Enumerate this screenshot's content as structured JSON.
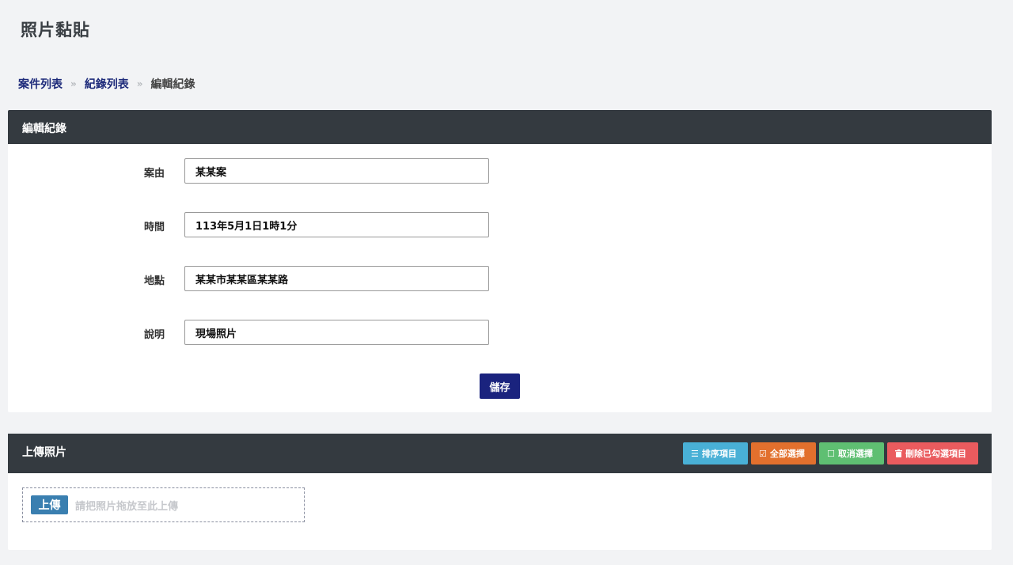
{
  "page": {
    "title": "照片黏貼"
  },
  "breadcrumb": {
    "items": [
      "案件列表",
      "紀錄列表"
    ],
    "separator": "»",
    "current": "編輯紀錄"
  },
  "edit_panel": {
    "title": "編輯紀錄",
    "fields": [
      {
        "label": "案由",
        "value": "某某案"
      },
      {
        "label": "時間",
        "value": "113年5月1日1時1分"
      },
      {
        "label": "地點",
        "value": "某某市某某區某某路"
      },
      {
        "label": "說明",
        "value": "現場照片"
      }
    ],
    "save_label": "儲存"
  },
  "upload_panel": {
    "title": "上傳照片",
    "toolbar": {
      "sort_label": "排序項目",
      "select_all_label": "全部選擇",
      "deselect_label": "取消選擇",
      "delete_label": "刪除已勾選項目"
    },
    "upload_button": "上傳",
    "drop_hint": "請把照片拖放至此上傳"
  },
  "colors": {
    "header_bg": "#343a40",
    "primary": "#1a237e",
    "sort": "#49b0d6",
    "select_all": "#e2702d",
    "deselect": "#5fbf72",
    "delete": "#ea5b5e"
  },
  "icons": {
    "sort": "list-icon",
    "select_all": "checkbox-checked-icon",
    "deselect": "checkbox-empty-icon",
    "delete": "trash-icon"
  }
}
